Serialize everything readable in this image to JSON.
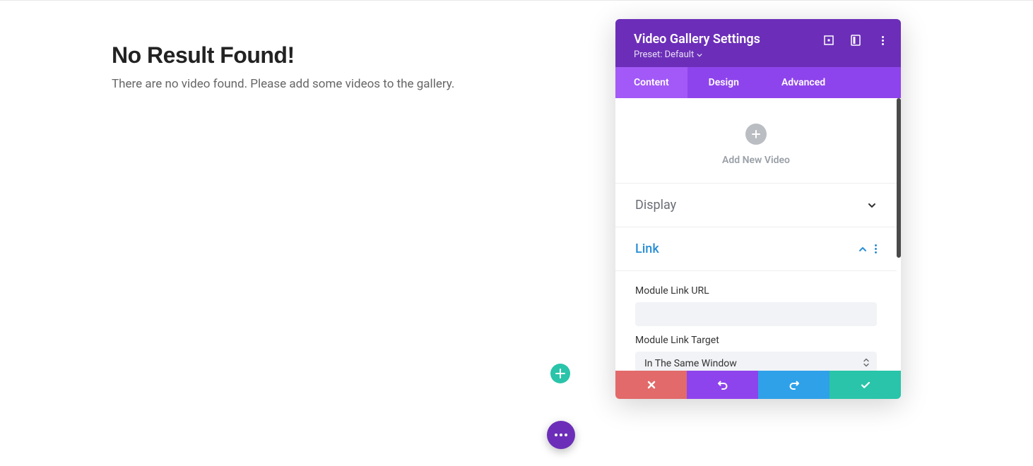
{
  "canvas": {
    "title": "No Result Found!",
    "subtitle": "There are no video found. Please add some videos to the gallery."
  },
  "panel": {
    "title": "Video Gallery Settings",
    "preset_label": "Preset: Default",
    "tabs": {
      "content": "Content",
      "design": "Design",
      "advanced": "Advanced"
    },
    "add_video_label": "Add New Video",
    "sections": {
      "display": {
        "title": "Display"
      },
      "link": {
        "title": "Link",
        "url_label": "Module Link URL",
        "url_value": "",
        "target_label": "Module Link Target",
        "target_value": "In The Same Window"
      }
    }
  }
}
